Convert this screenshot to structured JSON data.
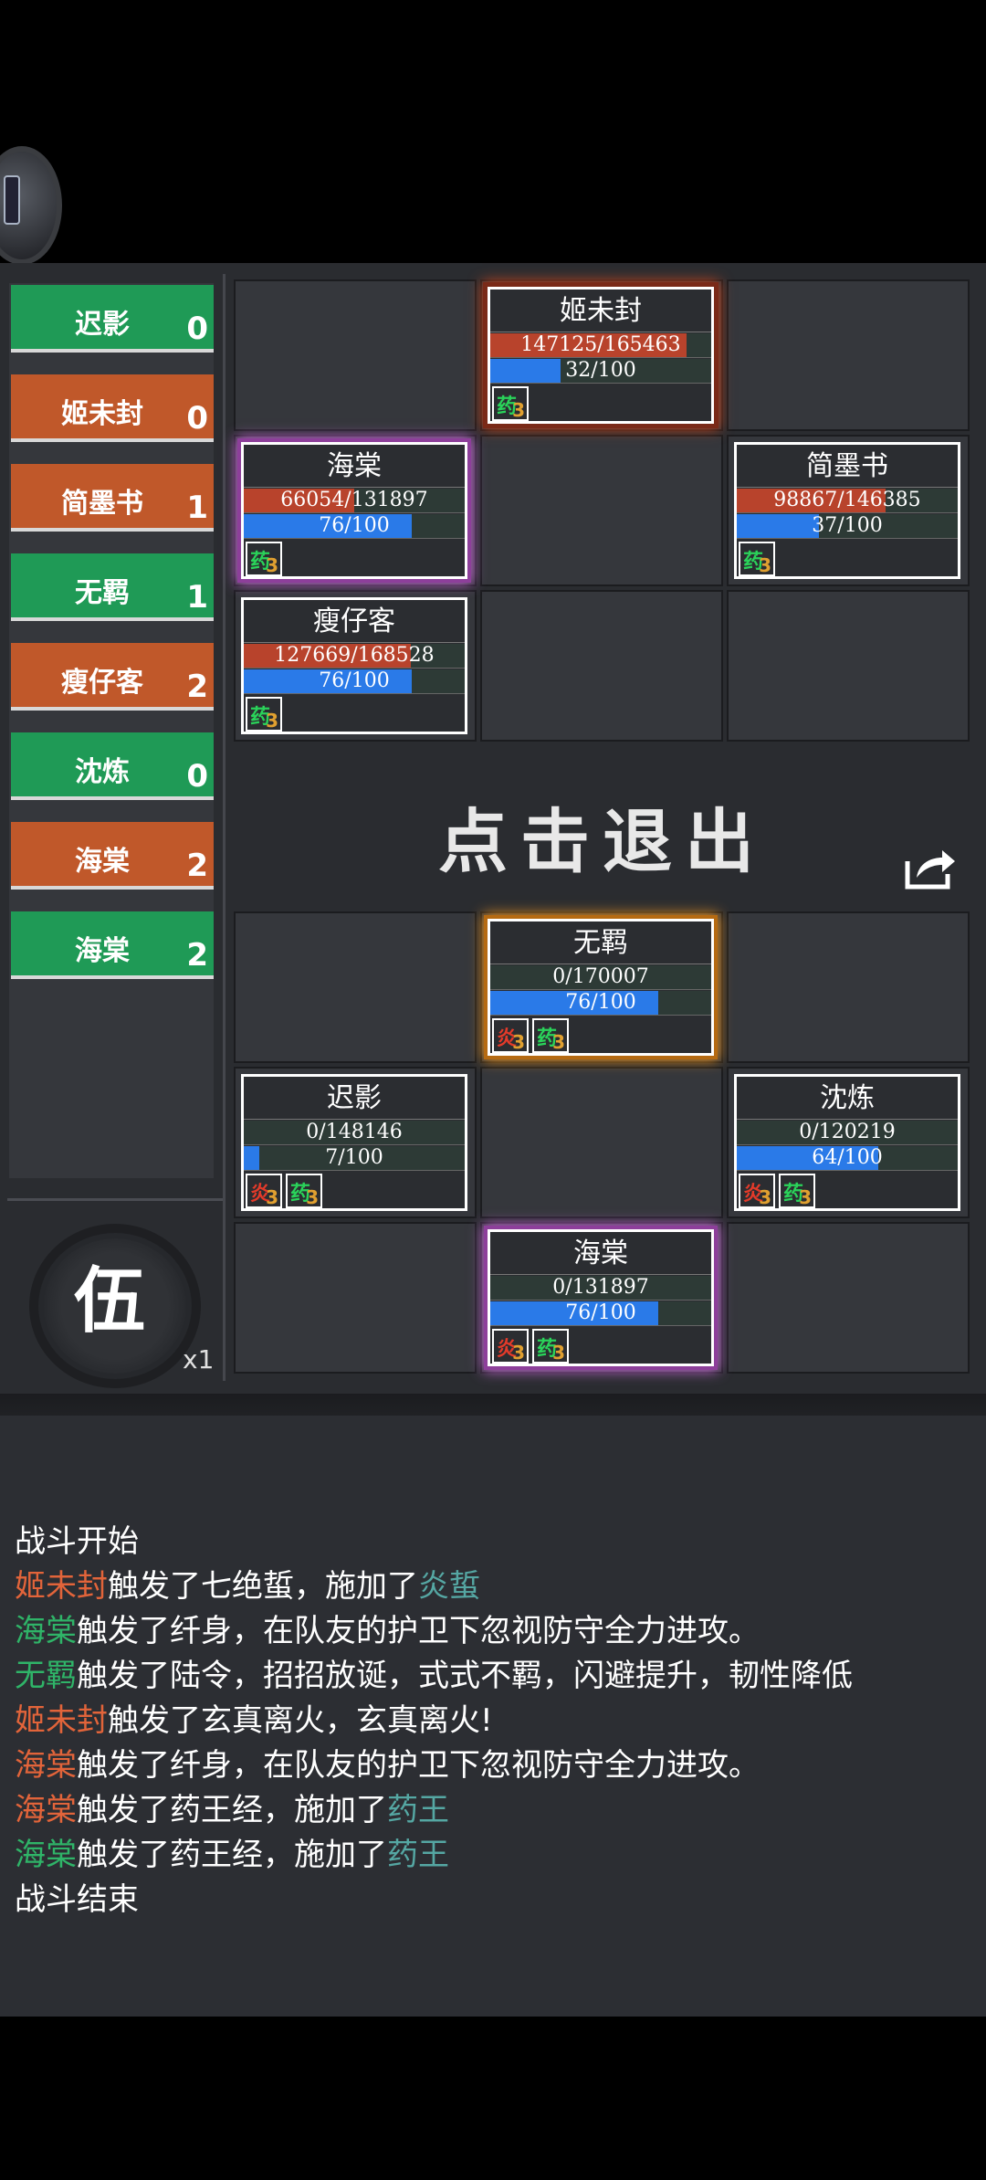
{
  "sidebar": {
    "items": [
      {
        "name": "迟影",
        "count": "0",
        "team": "green"
      },
      {
        "name": "姬未封",
        "count": "0",
        "team": "orange"
      },
      {
        "name": "简墨书",
        "count": "1",
        "team": "orange"
      },
      {
        "name": "无羁",
        "count": "1",
        "team": "green"
      },
      {
        "name": "瘦仔客",
        "count": "2",
        "team": "orange"
      },
      {
        "name": "沈炼",
        "count": "0",
        "team": "green"
      },
      {
        "name": "海棠",
        "count": "2",
        "team": "orange"
      },
      {
        "name": "海棠",
        "count": "2",
        "team": "green"
      }
    ],
    "round_char": "伍",
    "speed": "x1"
  },
  "colors": {
    "team_green": "#1f9a56",
    "team_orange": "#c0582a",
    "hp": "#b8432c",
    "mp": "#2a7ae8"
  },
  "enemy_cards": [
    {
      "name": "姬未封",
      "hp": "147125/165463",
      "hp_frac": 0.89,
      "mp": "32/100",
      "mp_frac": 0.32,
      "glow": "red",
      "buffs": [
        {
          "icon": "herb",
          "glyph": "药",
          "n": "3"
        }
      ]
    },
    {
      "name": "海棠",
      "hp": "66054/131897",
      "hp_frac": 0.5,
      "mp": "76/100",
      "mp_frac": 0.76,
      "glow": "purple",
      "buffs": [
        {
          "icon": "herb",
          "glyph": "药",
          "n": "3"
        }
      ]
    },
    {
      "name": "简墨书",
      "hp": "98867/146385",
      "hp_frac": 0.675,
      "mp": "37/100",
      "mp_frac": 0.37,
      "glow": "none",
      "buffs": [
        {
          "icon": "herb",
          "glyph": "药",
          "n": "3"
        }
      ]
    },
    {
      "name": "瘦仔客",
      "hp": "127669/168528",
      "hp_frac": 0.758,
      "mp": "76/100",
      "mp_frac": 0.76,
      "glow": "none",
      "buffs": [
        {
          "icon": "herb",
          "glyph": "药",
          "n": "3"
        }
      ]
    }
  ],
  "ally_cards": [
    {
      "name": "无羁",
      "hp": "0/170007",
      "hp_frac": 0,
      "mp": "76/100",
      "mp_frac": 0.76,
      "glow": "orange",
      "buffs": [
        {
          "icon": "fire",
          "glyph": "炎",
          "n": "3"
        },
        {
          "icon": "herb",
          "glyph": "药",
          "n": "3"
        }
      ]
    },
    {
      "name": "迟影",
      "hp": "0/148146",
      "hp_frac": 0,
      "mp": "7/100",
      "mp_frac": 0.07,
      "glow": "none",
      "buffs": [
        {
          "icon": "fire",
          "glyph": "炎",
          "n": "3"
        },
        {
          "icon": "herb",
          "glyph": "药",
          "n": "3"
        }
      ]
    },
    {
      "name": "沈炼",
      "hp": "0/120219",
      "hp_frac": 0,
      "mp": "64/100",
      "mp_frac": 0.64,
      "glow": "none",
      "buffs": [
        {
          "icon": "fire",
          "glyph": "炎",
          "n": "3"
        },
        {
          "icon": "herb",
          "glyph": "药",
          "n": "3"
        }
      ]
    },
    {
      "name": "海棠",
      "hp": "0/131897",
      "hp_frac": 0,
      "mp": "76/100",
      "mp_frac": 0.76,
      "glow": "purple",
      "buffs": [
        {
          "icon": "fire",
          "glyph": "炎",
          "n": "3"
        },
        {
          "icon": "herb",
          "glyph": "药",
          "n": "3"
        }
      ]
    }
  ],
  "exit_label": "点击退出",
  "share_icon": "share-icon",
  "log": [
    [
      {
        "t": "战斗开始",
        "c": "white"
      }
    ],
    [
      {
        "t": "姬未封",
        "c": "orange"
      },
      {
        "t": "触发了七绝蜇，施加了",
        "c": "white"
      },
      {
        "t": "炎蜇",
        "c": "teal"
      }
    ],
    [
      {
        "t": "海棠",
        "c": "green"
      },
      {
        "t": "触发了纤身，在队友的护卫下忽视防守全力进攻。",
        "c": "white"
      }
    ],
    [
      {
        "t": "无羁",
        "c": "green"
      },
      {
        "t": "触发了陆令，招招放诞，式式不羁，闪避提升，韧性降低",
        "c": "white"
      }
    ],
    [
      {
        "t": "姬未封",
        "c": "orange"
      },
      {
        "t": "触发了玄真离火，玄真离火!",
        "c": "white"
      }
    ],
    [
      {
        "t": "海棠",
        "c": "orange"
      },
      {
        "t": "触发了纤身，在队友的护卫下忽视防守全力进攻。",
        "c": "white"
      }
    ],
    [
      {
        "t": "海棠",
        "c": "orange"
      },
      {
        "t": "触发了药王经，施加了",
        "c": "white"
      },
      {
        "t": "药王",
        "c": "teal"
      }
    ],
    [
      {
        "t": "海棠",
        "c": "green"
      },
      {
        "t": "触发了药王经，施加了",
        "c": "white"
      },
      {
        "t": "药王",
        "c": "teal"
      }
    ],
    [
      {
        "t": "战斗结束",
        "c": "white"
      }
    ]
  ]
}
